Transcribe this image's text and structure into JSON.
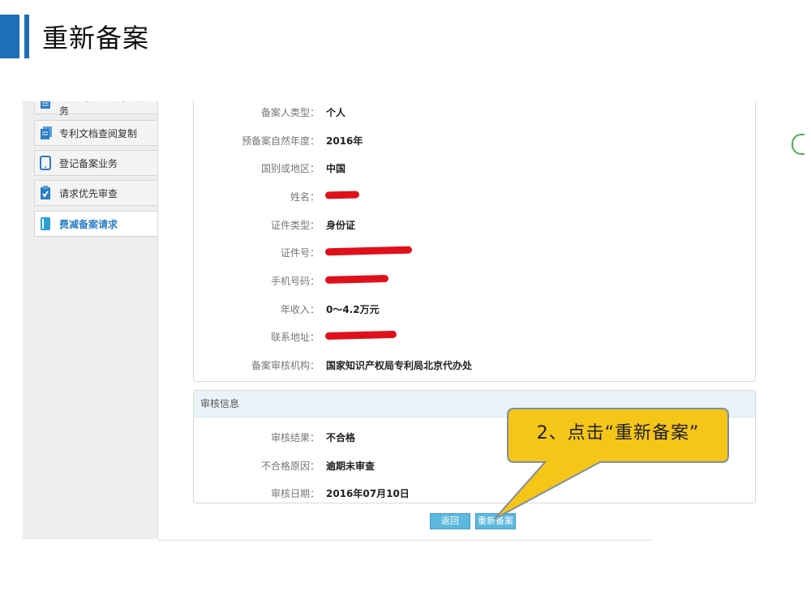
{
  "slide": {
    "title": "重新备案"
  },
  "sidebar": {
    "items": [
      {
        "label": "文件副本&证明文件业务",
        "icon": "document-list-icon"
      },
      {
        "label": "专利文档查阅复制",
        "icon": "documents-copy-icon"
      },
      {
        "label": "登记备案业务",
        "icon": "phone-register-icon"
      },
      {
        "label": "请求优先审查",
        "icon": "clipboard-check-icon"
      },
      {
        "label": "费减备案请求",
        "icon": "book-icon"
      }
    ]
  },
  "info": {
    "rows": [
      {
        "label": "备案人类型：",
        "value": "个人"
      },
      {
        "label": "预备案自然年度：",
        "value": "2016年"
      },
      {
        "label": "国别或地区：",
        "value": "中国"
      },
      {
        "label": "姓名：",
        "value": ""
      },
      {
        "label": "证件类型：",
        "value": "身份证"
      },
      {
        "label": "证件号：",
        "value": ""
      },
      {
        "label": "手机号码：",
        "value": ""
      },
      {
        "label": "年收入：",
        "value": "0～4.2万元"
      },
      {
        "label": "联系地址：",
        "value": ""
      },
      {
        "label": "备案审核机构：",
        "value": "国家知识产权局专利局北京代办处"
      }
    ]
  },
  "audit": {
    "header": "审核信息",
    "rows": [
      {
        "label": "审核结果：",
        "value": "不合格"
      },
      {
        "label": "不合格原因：",
        "value": "逾期未审查"
      },
      {
        "label": "审核日期：",
        "value": "2016年07月10日"
      }
    ]
  },
  "buttons": {
    "back": "返回",
    "refile": "重新备案"
  },
  "callout": {
    "text": "2、点击“重新备案”"
  },
  "colors": {
    "accent": "#1d6fb8",
    "callout_fill": "#f5c518",
    "redaction": "#e0101a",
    "button": "#5cb8de"
  }
}
